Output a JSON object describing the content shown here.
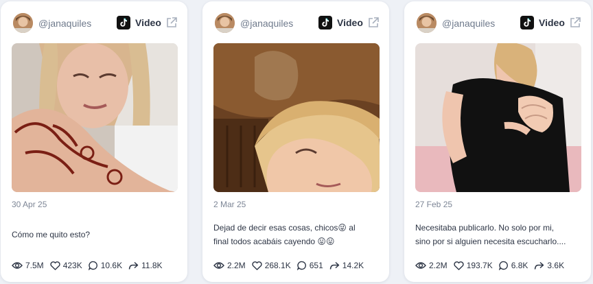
{
  "colors": {
    "page_bg": "#eef1f6",
    "card_bg": "#ffffff",
    "muted": "#7d8696",
    "text": "#2c3444"
  },
  "posts": [
    {
      "author": "@janaquiles",
      "platform_icon": "tiktok-icon",
      "type": "Video",
      "date": "30 Apr 25",
      "caption_lines": [
        "Cómo me quito esto?"
      ],
      "stats": {
        "views": "7.5M",
        "likes": "423K",
        "comments": "10.6K",
        "shares": "11.8K"
      }
    },
    {
      "author": "@janaquiles",
      "platform_icon": "tiktok-icon",
      "type": "Video",
      "date": "2 Mar 25",
      "caption_lines": [
        "Dejad de decir esas cosas, chicos😜 al",
        "final todos acabáis cayendo 😛😛"
      ],
      "stats": {
        "views": "2.2M",
        "likes": "268.1K",
        "comments": "651",
        "shares": "14.2K"
      }
    },
    {
      "author": "@janaquiles",
      "platform_icon": "tiktok-icon",
      "type": "Video",
      "date": "27 Feb 25",
      "caption_lines": [
        "Necesitaba publicarlo. No solo por mi,",
        "sino por si alguien necesita escucharlo...."
      ],
      "stats": {
        "views": "2.2M",
        "likes": "193.7K",
        "comments": "6.8K",
        "shares": "3.6K"
      }
    }
  ]
}
